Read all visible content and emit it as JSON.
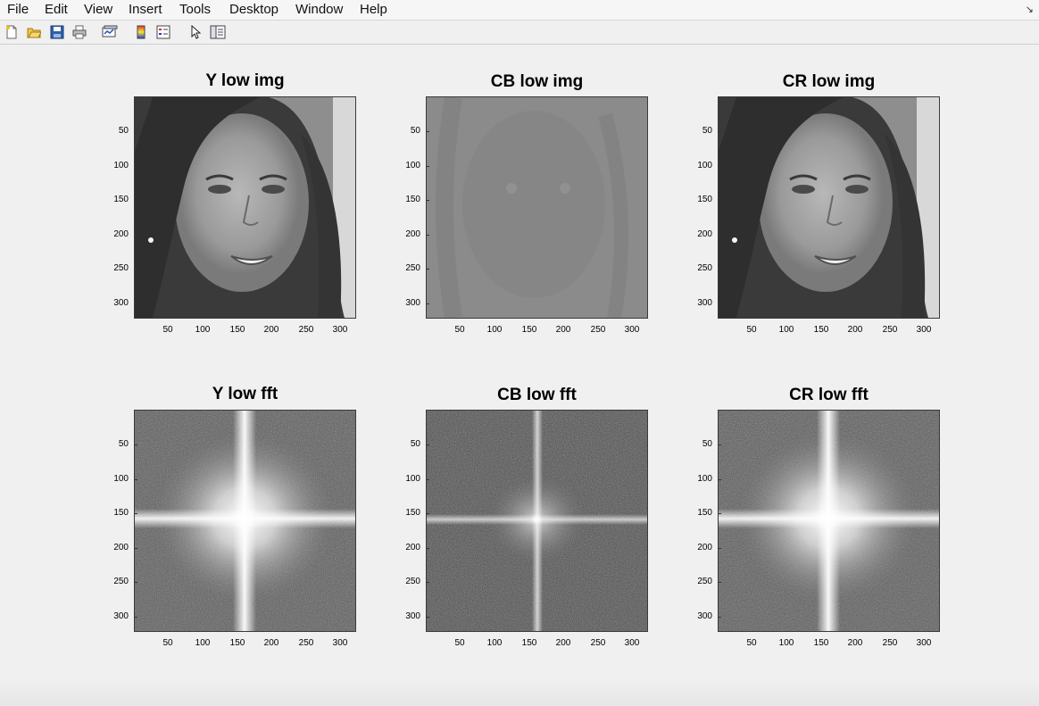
{
  "menu": {
    "items": [
      "File",
      "Edit",
      "View",
      "Insert",
      "Tools",
      "Desktop",
      "Window",
      "Help"
    ]
  },
  "toolbar": {
    "icons": [
      "new-figure-icon",
      "open-file-icon",
      "save-icon",
      "print-icon",
      "link-plot-icon",
      "colorbar-icon",
      "legend-icon",
      "edit-plot-arrow-icon",
      "property-inspector-icon"
    ]
  },
  "panels": {
    "p0": {
      "title": "Y low img"
    },
    "p1": {
      "title": "CB low img"
    },
    "p2": {
      "title": "CR low img"
    },
    "p3": {
      "title": "Y low fft"
    },
    "p4": {
      "title": "CB low fft"
    },
    "p5": {
      "title": "CR low fft"
    }
  },
  "axis": {
    "y_ticks": [
      "50",
      "100",
      "150",
      "200",
      "250",
      "300"
    ],
    "x_ticks": [
      "50",
      "100",
      "150",
      "200",
      "250",
      "300"
    ]
  }
}
